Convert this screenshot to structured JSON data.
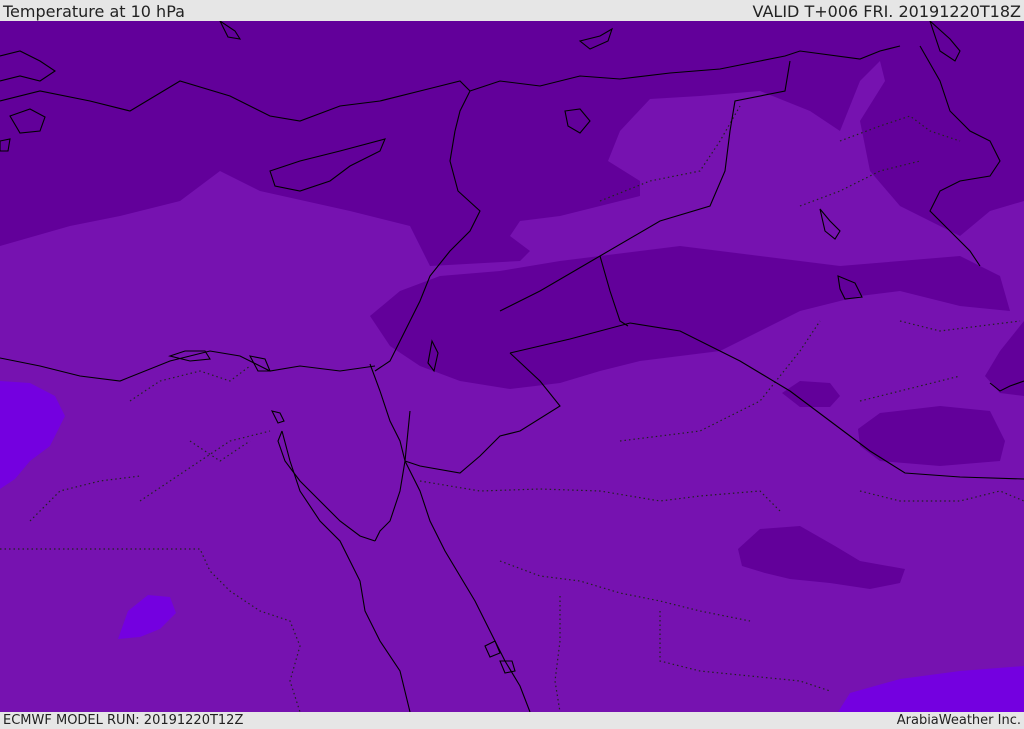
{
  "header": {
    "title": "Temperature at 10 hPa",
    "valid_time": "VALID T+006 FRI. 20191220T18Z"
  },
  "footer": {
    "model_run": "ECMWF MODEL RUN: 20191220T12Z",
    "credit": "ArabiaWeather Inc."
  },
  "map": {
    "field_colors": {
      "darker": "#62009a",
      "base": "#7612b0",
      "warmest": "#7400e0"
    },
    "coastline_color": "#000000",
    "border_style": "dotted"
  }
}
